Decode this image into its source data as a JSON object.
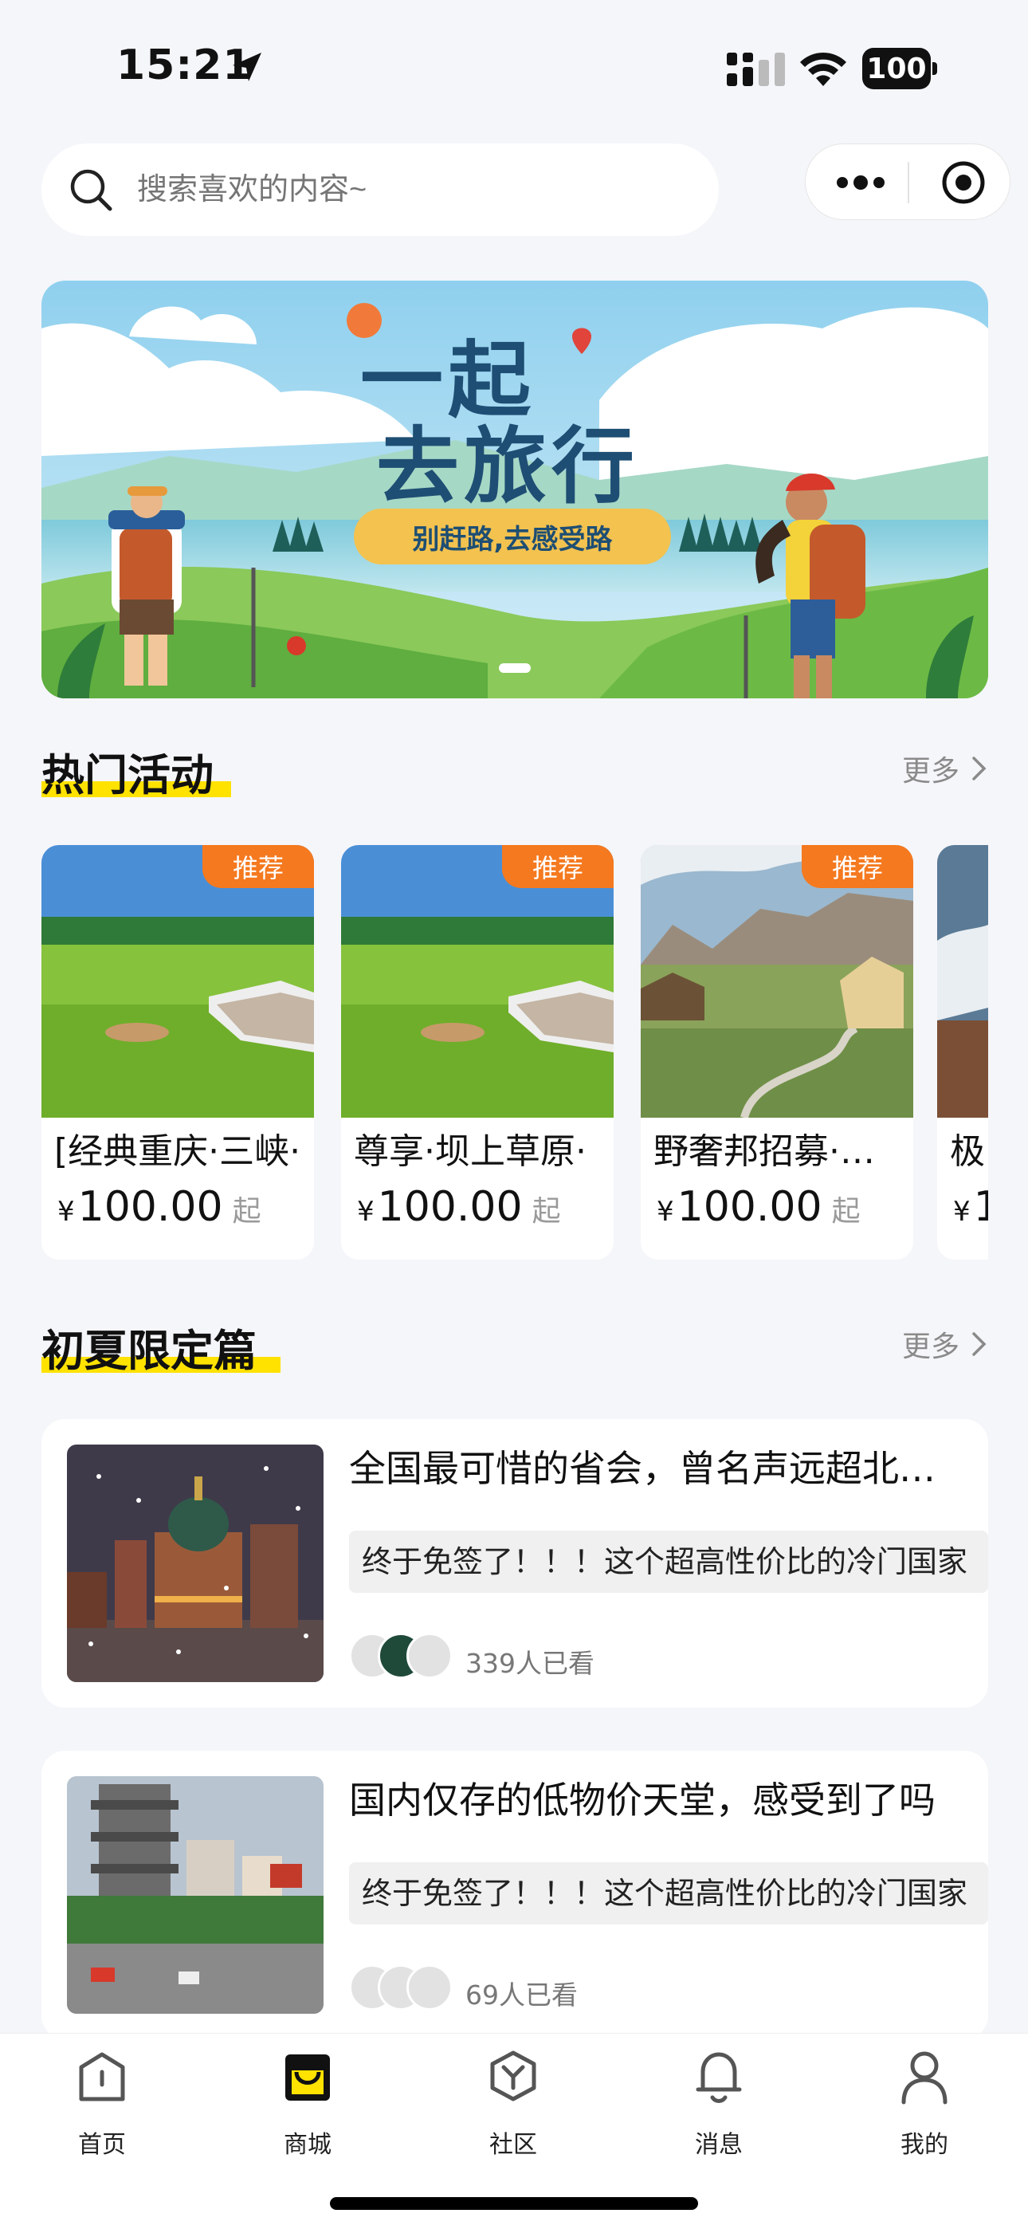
{
  "status_bar": {
    "time": "15:21",
    "battery": "100"
  },
  "search": {
    "placeholder": "搜索喜欢的内容~"
  },
  "banner": {
    "line1": "一起",
    "line2": "去旅行",
    "slogan": "别赶路,去感受路"
  },
  "hot": {
    "title": "热门活动",
    "more": "更多",
    "items": [
      {
        "badge": "推荐",
        "name": "[经典重庆·三峡·",
        "price": "100.00",
        "suffix": "起",
        "currency": "¥"
      },
      {
        "badge": "推荐",
        "name": "尊享·坝上草原·",
        "price": "100.00",
        "suffix": "起",
        "currency": "¥"
      },
      {
        "badge": "推荐",
        "name": "野奢邦招募·新疆",
        "price": "100.00",
        "suffix": "起",
        "currency": "¥"
      },
      {
        "badge": "",
        "name": "极",
        "price": "1",
        "suffix": "",
        "currency": "¥"
      }
    ]
  },
  "summer": {
    "title": "初夏限定篇",
    "more": "更多",
    "articles": [
      {
        "title": "全国最可惜的省会，曾名声远超北上广",
        "summary": "终于免签了！！！这个超高性价比的冷门国家",
        "views": "339人已看"
      },
      {
        "title": "国内仅存的低物价天堂，感受到了吗",
        "summary": "终于免签了！！！这个超高性价比的冷门国家",
        "views": "69人已看"
      }
    ]
  },
  "tabbar": {
    "items": [
      {
        "label": "首页",
        "icon": "home-icon"
      },
      {
        "label": "商城",
        "icon": "shop-bag-icon",
        "active": true
      },
      {
        "label": "社区",
        "icon": "community-icon"
      },
      {
        "label": "消息",
        "icon": "bell-icon"
      },
      {
        "label": "我的",
        "icon": "profile-icon"
      }
    ]
  },
  "colors": {
    "accent": "#ffe200",
    "badge": "#f5791f",
    "banner_title": "#1e4e73"
  }
}
